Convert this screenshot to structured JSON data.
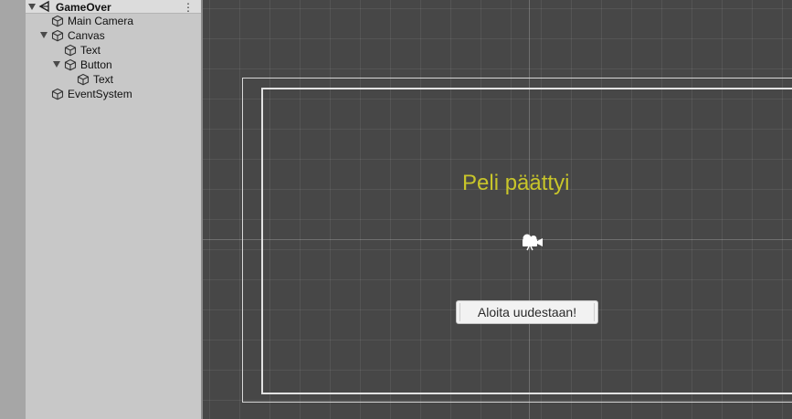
{
  "hierarchy": {
    "scene": {
      "label": "GameOver",
      "menu_glyph": "⋮"
    },
    "items": [
      {
        "label": "Main Camera"
      },
      {
        "label": "Canvas"
      },
      {
        "label": "Text"
      },
      {
        "label": "Button"
      },
      {
        "label": "Text"
      },
      {
        "label": "EventSystem"
      }
    ]
  },
  "scene_view": {
    "title_text": "Peli päättyi",
    "button_label": "Aloita uudestaan!",
    "title_color": "#c8c52a",
    "background_color": "#474747"
  },
  "icons": {
    "scene": "unity-scene-icon",
    "gameobject": "cube-icon",
    "camera": "camera-gizmo-icon"
  }
}
